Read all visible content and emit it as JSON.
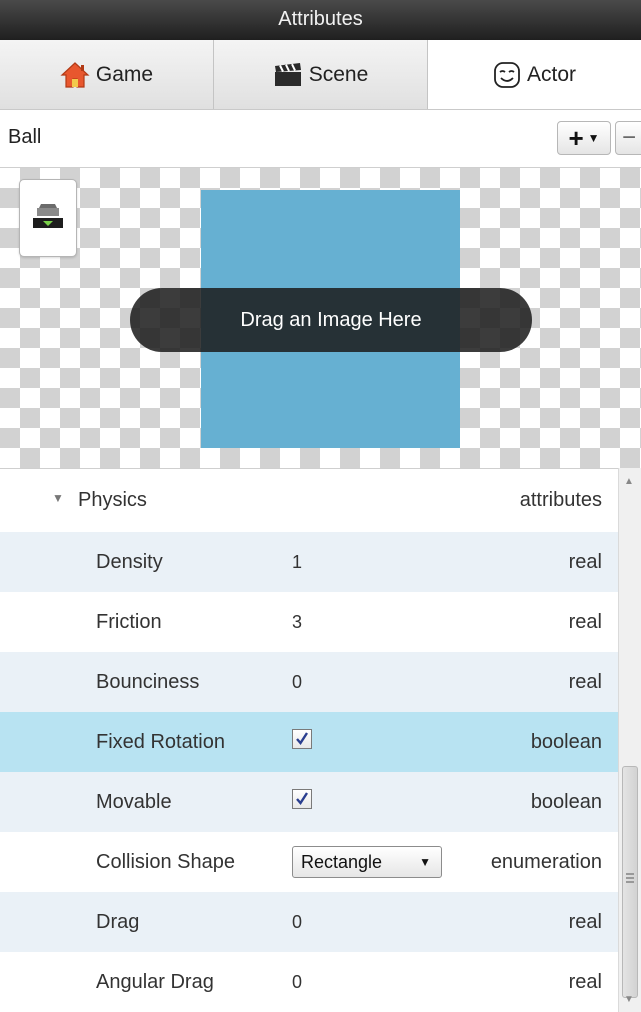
{
  "window": {
    "title": "Attributes"
  },
  "tabs": [
    {
      "label": "Game",
      "icon": "home-icon",
      "active": false
    },
    {
      "label": "Scene",
      "icon": "clapperboard-icon",
      "active": false
    },
    {
      "label": "Actor",
      "icon": "mask-icon",
      "active": true
    }
  ],
  "actor": {
    "name": "Ball",
    "add_label": "+",
    "remove_label": "−"
  },
  "image_area": {
    "drag_hint": "Drag an Image Here",
    "preview_color": "#66b0d2"
  },
  "physics": {
    "group_name": "Physics",
    "group_type": "attributes",
    "rows": [
      {
        "name": "Density",
        "value": "1",
        "type": "real"
      },
      {
        "name": "Friction",
        "value": "3",
        "type": "real"
      },
      {
        "name": "Bounciness",
        "value": "0",
        "type": "real"
      },
      {
        "name": "Fixed Rotation",
        "value": true,
        "type": "boolean",
        "selected": true
      },
      {
        "name": "Movable",
        "value": true,
        "type": "boolean"
      },
      {
        "name": "Collision Shape",
        "value": "Rectangle",
        "type": "enumeration"
      },
      {
        "name": "Drag",
        "value": "0",
        "type": "real"
      },
      {
        "name": "Angular Drag",
        "value": "0",
        "type": "real"
      }
    ]
  },
  "colors": {
    "selected_row": "#b8e3f2",
    "odd_row": "#eaf1f7",
    "titlebar": "#2b2b2b"
  }
}
